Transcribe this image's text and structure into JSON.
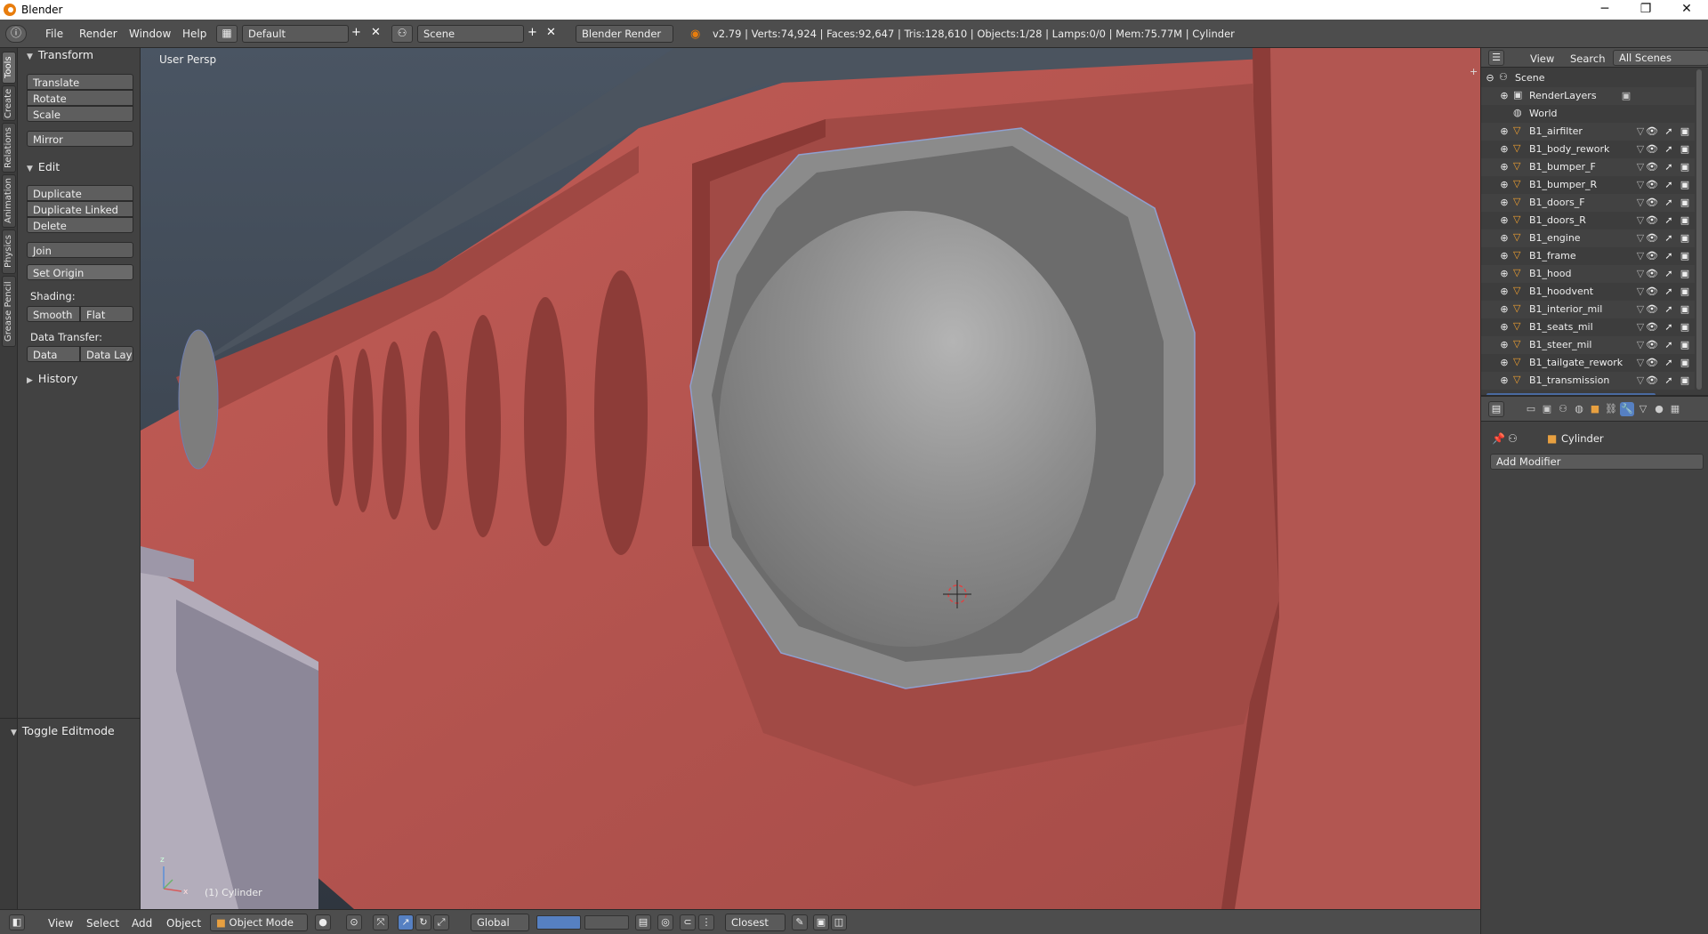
{
  "window": {
    "title": "Blender",
    "minimize": "─",
    "maximize": "❐",
    "close": "✕"
  },
  "topbar": {
    "menus": [
      "File",
      "Render",
      "Window",
      "Help"
    ],
    "layout": "Default",
    "scene": "Scene",
    "engine": "Blender Render",
    "stats": "v2.79 | Verts:74,924 | Faces:92,647 | Tris:128,610 | Objects:1/28 | Lamps:0/0 | Mem:75.77M | Cylinder"
  },
  "tabs": [
    "Tools",
    "Create",
    "Relations",
    "Animation",
    "Physics",
    "Grease Pencil"
  ],
  "toolshelf": {
    "transform_header": "Transform",
    "transform": [
      "Translate",
      "Rotate",
      "Scale"
    ],
    "mirror": "Mirror",
    "edit_header": "Edit",
    "edit": [
      "Duplicate",
      "Duplicate Linked",
      "Delete"
    ],
    "join": "Join",
    "set_origin": "Set Origin",
    "shading_label": "Shading:",
    "smooth": "Smooth",
    "flat": "Flat",
    "data_transfer_label": "Data Transfer:",
    "data": "Data",
    "data_layout": "Data Layo",
    "history_header": "History",
    "toggle_editmode_header": "Toggle Editmode"
  },
  "viewport": {
    "view_label": "User Persp",
    "object_label": "(1) Cylinder"
  },
  "bottombar": {
    "menus": [
      "View",
      "Select",
      "Add",
      "Object"
    ],
    "mode": "Object Mode",
    "orientation": "Global",
    "snap": "Closest"
  },
  "outliner": {
    "view": "View",
    "search": "Search",
    "all_scenes": "All Scenes",
    "scene": "Scene",
    "render_layers": "RenderLayers",
    "world": "World",
    "objects": [
      "B1_airfilter",
      "B1_body_rework",
      "B1_bumper_F",
      "B1_bumper_R",
      "B1_doors_F",
      "B1_doors_R",
      "B1_engine",
      "B1_frame",
      "B1_hood",
      "B1_hoodvent",
      "B1_interior_mil",
      "B1_seats_mil",
      "B1_steer_mil",
      "B1_tailgate_rework",
      "B1_transmission"
    ]
  },
  "properties": {
    "object": "Cylinder",
    "add_modifier": "Add Modifier"
  },
  "colors": {
    "accent": "#5680c2",
    "body": "#b5534f",
    "lamp": "#8e8e8e"
  }
}
